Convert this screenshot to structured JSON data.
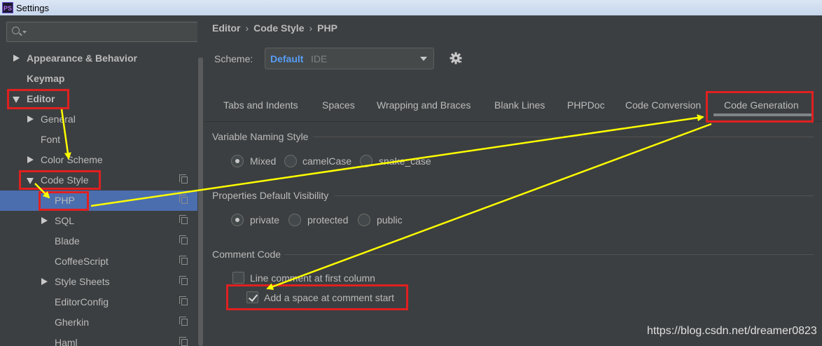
{
  "window": {
    "title": "Settings",
    "logo_text": "PS"
  },
  "search": {
    "placeholder": "",
    "value": ""
  },
  "sidebar": {
    "items": [
      {
        "label": "Appearance & Behavior"
      },
      {
        "label": "Keymap"
      },
      {
        "label": "Editor"
      },
      {
        "label": "General"
      },
      {
        "label": "Font"
      },
      {
        "label": "Color Scheme"
      },
      {
        "label": "Code Style"
      },
      {
        "label": "PHP"
      },
      {
        "label": "SQL"
      },
      {
        "label": "Blade"
      },
      {
        "label": "CoffeeScript"
      },
      {
        "label": "Style Sheets"
      },
      {
        "label": "EditorConfig"
      },
      {
        "label": "Gherkin"
      },
      {
        "label": "Haml"
      }
    ]
  },
  "breadcrumb": {
    "parts": [
      "Editor",
      "Code Style",
      "PHP"
    ],
    "separator": "›"
  },
  "scheme": {
    "label": "Scheme:",
    "name": "Default",
    "scope": "IDE"
  },
  "tabs": [
    {
      "label": "Tabs and Indents"
    },
    {
      "label": "Spaces"
    },
    {
      "label": "Wrapping and Braces"
    },
    {
      "label": "Blank Lines"
    },
    {
      "label": "PHPDoc"
    },
    {
      "label": "Code Conversion"
    },
    {
      "label": "Code Generation",
      "active": true
    }
  ],
  "sections": {
    "naming": {
      "title": "Variable Naming Style",
      "options": [
        {
          "label": "Mixed",
          "checked": true
        },
        {
          "label": "camelCase",
          "checked": false
        },
        {
          "label": "snake_case",
          "checked": false
        }
      ]
    },
    "visibility": {
      "title": "Properties Default Visibility",
      "options": [
        {
          "label": "private",
          "checked": true
        },
        {
          "label": "protected",
          "checked": false
        },
        {
          "label": "public",
          "checked": false
        }
      ]
    },
    "comment": {
      "title": "Comment Code",
      "options": [
        {
          "label": "Line comment at first column",
          "checked": false
        },
        {
          "label": "Add a space at comment start",
          "checked": true
        }
      ]
    }
  },
  "watermark": "https://blog.csdn.net/dreamer0823",
  "colors": {
    "background": "#3c3f41",
    "selection": "#4b6eaf",
    "scheme_name": "#589df6",
    "annotation_box": "#e02020",
    "annotation_arrow": "#ffff00"
  },
  "icons": [
    "search-icon",
    "dropdown-caret-icon",
    "expand-arrow-icon",
    "collapse-arrow-icon",
    "copy-icon",
    "gear-icon",
    "checkmark-icon"
  ]
}
